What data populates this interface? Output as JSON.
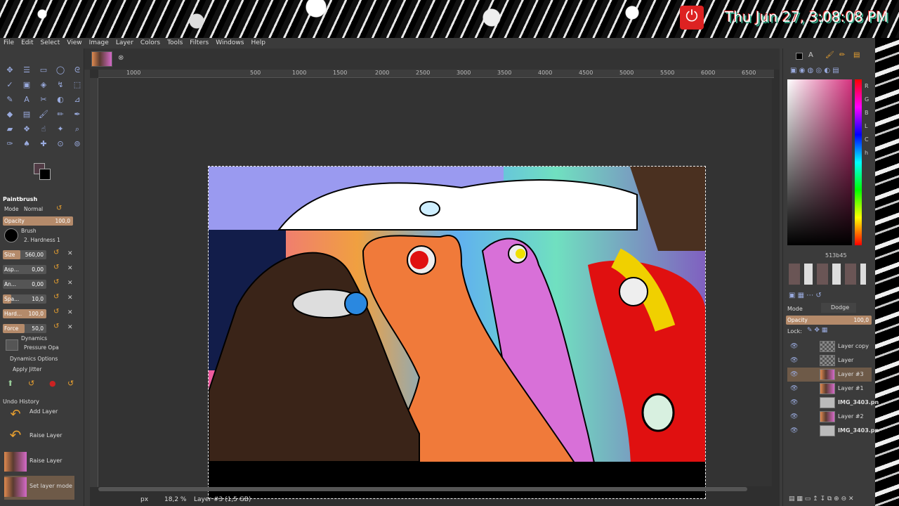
{
  "desktop": {
    "clock": "Thu Jun 27, 3:08:08 PM"
  },
  "menubar": {
    "items": [
      "File",
      "Edit",
      "Select",
      "View",
      "Image",
      "Layer",
      "Colors",
      "Tools",
      "Filters",
      "Windows",
      "Help"
    ]
  },
  "tool_options": {
    "title": "Paintbrush",
    "mode_label": "Mode",
    "mode_value": "Normal",
    "opacity_label": "Opacity",
    "opacity_value": "100,0",
    "opacity_fraction": 1.0,
    "brush_label": "Brush",
    "brush_value": "2. Hardness 1",
    "size_label": "Size",
    "size_value": "560,00",
    "aspect_label": "Asp...",
    "aspect_value": "0,00",
    "angle_label": "An...",
    "angle_value": "0,00",
    "spacing_label": "Spa...",
    "spacing_value": "10,0",
    "hardness_label": "Hard...",
    "hardness_value": "100,0",
    "force_label": "Force",
    "force_value": "50,0",
    "dynamics_label": "Dynamics",
    "dynamics_value": "Pressure Opa",
    "dynamics_options": "Dynamics Options",
    "apply_jitter": "Apply Jitter"
  },
  "undo_history": {
    "title": "Undo History",
    "items": [
      "Add Layer",
      "Raise Layer",
      "Raise Layer",
      "Set layer mode"
    ]
  },
  "rulers": {
    "labels": [
      "1000",
      "500",
      "1000",
      "1500",
      "2000",
      "2500",
      "3000",
      "3500",
      "4000",
      "4500",
      "5000",
      "5500",
      "6000",
      "6500"
    ]
  },
  "status": {
    "unit": "px",
    "zoom": "18,2 %",
    "layer_info": "Layer #3 (1,5 GB)"
  },
  "colors": {
    "hex": "513b45",
    "rgb_letters": [
      "R",
      "G",
      "B",
      "L",
      "C",
      "h"
    ]
  },
  "layers_panel": {
    "mode_label": "Mode",
    "mode_value": "Dodge",
    "opacity_label": "Opacity",
    "opacity_value": "100,0",
    "lock_label": "Lock:",
    "layers": [
      "Layer copy",
      "Layer",
      "Layer #3",
      "Layer #1",
      "IMG_3403.pn",
      "Layer #2",
      "IMG_3403.pn"
    ],
    "active_index": 2
  }
}
